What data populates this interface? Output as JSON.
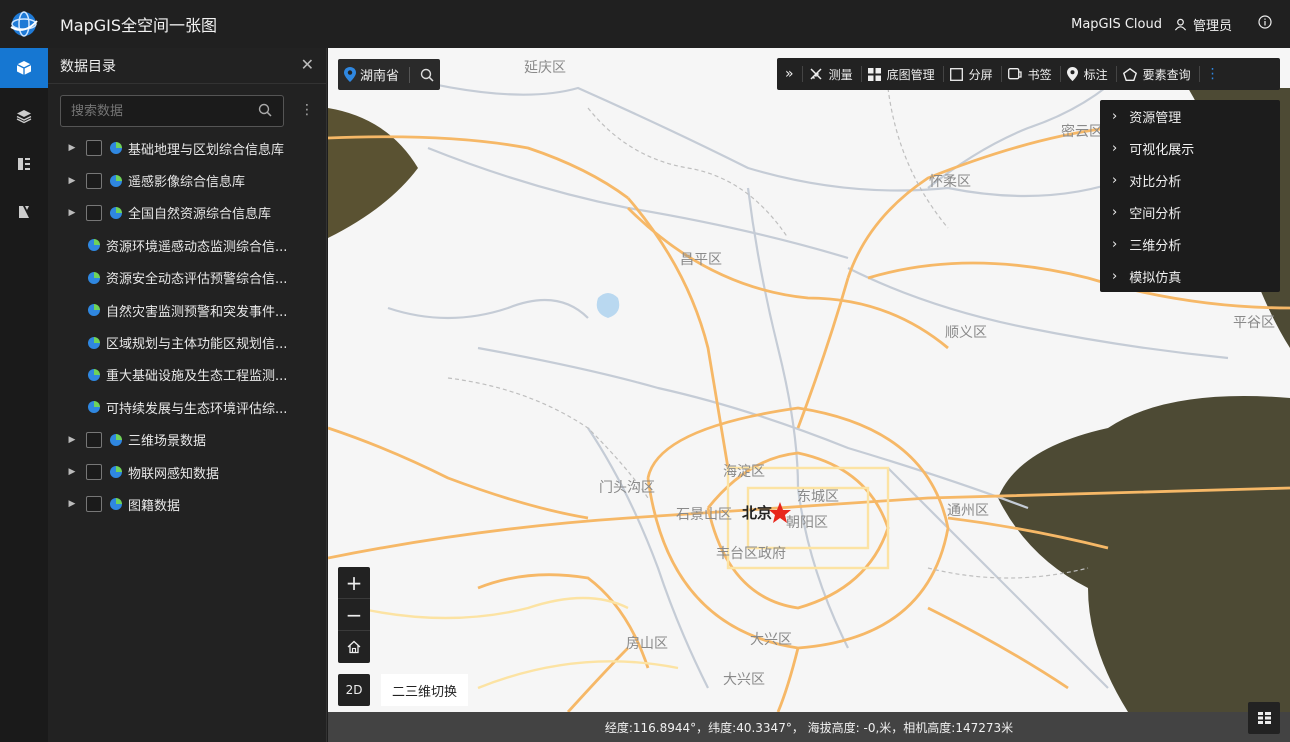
{
  "app": {
    "title": "MapGIS全空间一张图"
  },
  "header": {
    "cloud_label": "MapGIS Cloud",
    "user_name": "管理员"
  },
  "panel": {
    "title": "数据目录",
    "search_placeholder": "搜索数据",
    "tree": [
      {
        "label": "基础地理与区划综合信息库",
        "type": "group"
      },
      {
        "label": "遥感影像综合信息库",
        "type": "group"
      },
      {
        "label": "全国自然资源综合信息库",
        "type": "group"
      },
      {
        "label": "资源环境遥感动态监测综合信...",
        "type": "leaf"
      },
      {
        "label": "资源安全动态评估预警综合信...",
        "type": "leaf"
      },
      {
        "label": "自然灾害监测预警和突发事件...",
        "type": "leaf"
      },
      {
        "label": "区域规划与主体功能区规划信...",
        "type": "leaf"
      },
      {
        "label": "重大基础设施及生态工程监测...",
        "type": "leaf"
      },
      {
        "label": "可持续发展与生态环境评估综...",
        "type": "leaf"
      },
      {
        "label": "三维场景数据",
        "type": "group"
      },
      {
        "label": "物联网感知数据",
        "type": "group"
      },
      {
        "label": "图籍数据",
        "type": "group"
      }
    ]
  },
  "map": {
    "location": "湖南省",
    "toolbar": [
      "测量",
      "底图管理",
      "分屏",
      "书签",
      "标注",
      "要素查询"
    ],
    "dropdown": [
      "资源管理",
      "可视化展示",
      "对比分析",
      "空间分析",
      "三维分析",
      "模拟仿真"
    ],
    "labels": {
      "yanqing": "延庆区",
      "miyun": "密云区",
      "huairou": "怀柔区",
      "changping": "昌平区",
      "shunyi": "顺义区",
      "pinggu": "平谷区",
      "mentougou": "门头沟区",
      "haidian": "海淀区",
      "dongcheng": "东城区",
      "shijingshan": "石景山区",
      "beijing": "北京",
      "chaoyang": "朝阳区",
      "tongzhou": "通州区",
      "fengtai": "丰台区政府",
      "fangshan": "房山区",
      "daxing": "大兴区",
      "daxing2": "大兴区"
    },
    "mode_label": "2D",
    "switch_label": "二三维切换",
    "status": "经度:116.8944°，纬度:40.3347°， 海拔高度: -0,米，相机高度:147273米"
  }
}
